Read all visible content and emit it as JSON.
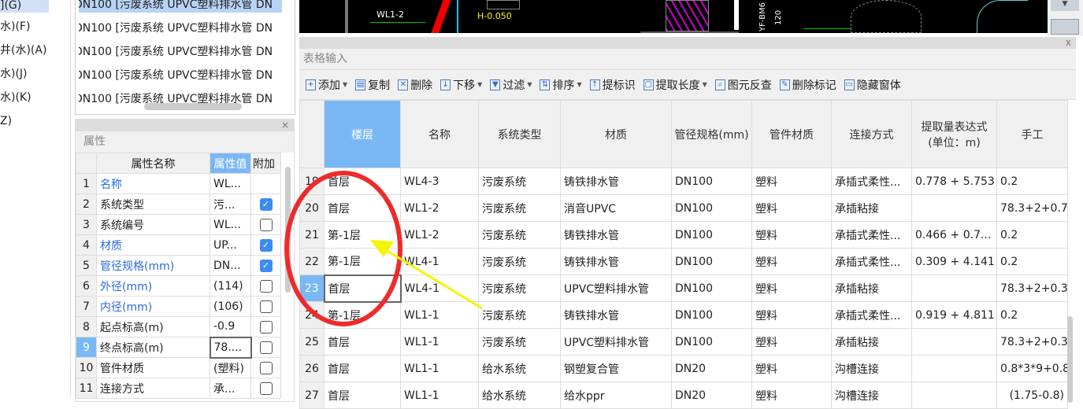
{
  "left_nav": {
    "items": [
      "](G)",
      "水)(F)",
      "井(水)(A)",
      "水)(J)",
      "水)(K)",
      "Z)"
    ]
  },
  "pipe_list": {
    "items": [
      "DN100 [污废系统 UPVC塑料排水管 DN",
      "DN100 [污废系统 UPVC塑料排水管 DN",
      "DN100 [污废系统 UPVC塑料排水管 DN",
      "DN100 [污废系统 UPVC塑料排水管 DN",
      "DN100 [污废系统 UPVC塑料排水管 DN"
    ]
  },
  "cad": {
    "labels": [
      "WL1-2",
      "H-0.050",
      "YF-BM6",
      "120"
    ]
  },
  "properties": {
    "title": "属性",
    "close": "×",
    "headers": [
      "属性名称",
      "属性值",
      "附加"
    ],
    "rows": [
      {
        "n": "1",
        "name": "名称",
        "value": "WL...",
        "blue": true,
        "check": null
      },
      {
        "n": "2",
        "name": "系统类型",
        "value": "污...",
        "blue": false,
        "check": true
      },
      {
        "n": "3",
        "name": "系统编号",
        "value": "WL...",
        "blue": false,
        "check": false
      },
      {
        "n": "4",
        "name": "材质",
        "value": "UP...",
        "blue": true,
        "check": true
      },
      {
        "n": "5",
        "name": "管径规格(mm)",
        "value": "DN...",
        "blue": true,
        "check": true
      },
      {
        "n": "6",
        "name": "外径(mm)",
        "value": "(114)",
        "blue": true,
        "check": false
      },
      {
        "n": "7",
        "name": "内径(mm)",
        "value": "(106)",
        "blue": true,
        "check": false
      },
      {
        "n": "8",
        "name": "起点标高(m)",
        "value": "-0.9",
        "blue": false,
        "check": false
      },
      {
        "n": "9",
        "name": "终点标高(m)",
        "value": "78....",
        "blue": false,
        "check": false,
        "selected": true
      },
      {
        "n": "10",
        "name": "管件材质",
        "value": "(塑料)",
        "blue": false,
        "check": false
      },
      {
        "n": "11",
        "name": "连接方式",
        "value": "承...",
        "blue": false,
        "check": false
      }
    ]
  },
  "grid": {
    "title": "表格输入",
    "close": "x",
    "toolbar": [
      "添加",
      "复制",
      "删除",
      "下移",
      "过滤",
      "排序",
      "提标识",
      "提取长度",
      "图元反查",
      "删除标记",
      "隐藏窗体"
    ],
    "headers": [
      "楼层",
      "名称",
      "系统类型",
      "材质",
      "管径规格(mm)",
      "管件材质",
      "连接方式",
      "提取量表达式\n(单位：m)",
      "手工"
    ],
    "rows": [
      [
        "19",
        "首层",
        "WL4-3",
        "污废系统",
        "铸铁排水管",
        "DN100",
        "塑料",
        "承插式柔性...",
        "0.778 + 5.753",
        "0.2"
      ],
      [
        "20",
        "首层",
        "WL1-2",
        "污废系统",
        "消音UPVC",
        "DN100",
        "塑料",
        "承插粘接",
        "",
        "78.3+2+0.7"
      ],
      [
        "21",
        "第-1层",
        "WL1-2",
        "污废系统",
        "铸铁排水管",
        "DN100",
        "塑料",
        "承插式柔性...",
        "0.466 + 0.7...",
        "0.2"
      ],
      [
        "22",
        "第-1层",
        "WL4-1",
        "污废系统",
        "铸铁排水管",
        "DN100",
        "塑料",
        "承插式柔性...",
        "0.309 + 4.141",
        "0.2"
      ],
      [
        "23",
        "首层",
        "WL4-1",
        "污废系统",
        "UPVC塑料排水管",
        "DN100",
        "塑料",
        "承插粘接",
        "",
        "78.3+2+0.3"
      ],
      [
        "24",
        "第-1层",
        "WL1-1",
        "污废系统",
        "铸铁排水管",
        "DN100",
        "塑料",
        "承插式柔性...",
        "0.919 + 4.811",
        "0.2"
      ],
      [
        "25",
        "首层",
        "WL1-1",
        "污废系统",
        "UPVC塑料排水管",
        "DN100",
        "塑料",
        "承插粘接",
        "",
        "78.3+2+0.3"
      ],
      [
        "26",
        "首层",
        "WL1-1",
        "给水系统",
        "钢塑复合管",
        "DN20",
        "塑料",
        "沟槽连接",
        "",
        "0.8*3*9+0.8"
      ],
      [
        "27",
        "首层",
        "WL1-1",
        "给水系统",
        "给水ppr",
        "DN20",
        "塑料",
        "沟槽连接",
        "",
        "(1.75-0.8)"
      ]
    ],
    "selected_row": "23"
  },
  "colors": {
    "accent": "#7ab8f5",
    "annotation_red": "#ee2b2b",
    "annotation_yellow": "#f5f500"
  }
}
